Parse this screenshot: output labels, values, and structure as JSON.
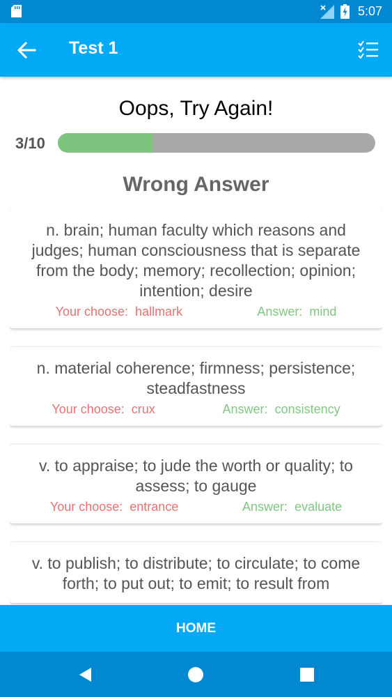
{
  "status_bar": {
    "time": "5:07"
  },
  "app_bar": {
    "title": "Test 1"
  },
  "result": {
    "title": "Oops, Try Again!",
    "progress_label": "3/10",
    "progress_fraction": 0.3
  },
  "section_title": "Wrong Answer",
  "card_labels": {
    "your_choice": "Your choose:",
    "answer": "Answer:"
  },
  "cards": [
    {
      "definition": "n. brain; human faculty which reasons and judges; human consciousness that is separate from the body; memory; recollection; opinion; intention; desire",
      "your_choice": "hallmark",
      "answer": "mind"
    },
    {
      "definition": "n. material coherence; firmness; persistence; steadfastness",
      "your_choice": "crux",
      "answer": "consistency"
    },
    {
      "definition": "v. to appraise; to jude the worth or quality; to assess; to gauge",
      "your_choice": "entrance",
      "answer": "evaluate"
    },
    {
      "definition": "v. to publish; to distribute; to circulate; to come forth; to put out; to emit; to result from",
      "your_choice": "",
      "answer": ""
    }
  ],
  "bottom_button": {
    "label": "HOME"
  },
  "colors": {
    "primary": "#03a9f4",
    "primary_dark": "#0288d1",
    "wrong": "#e57373",
    "correct": "#81c784",
    "progress_fill": "#7dc47f",
    "progress_track": "#a8a8aa"
  }
}
